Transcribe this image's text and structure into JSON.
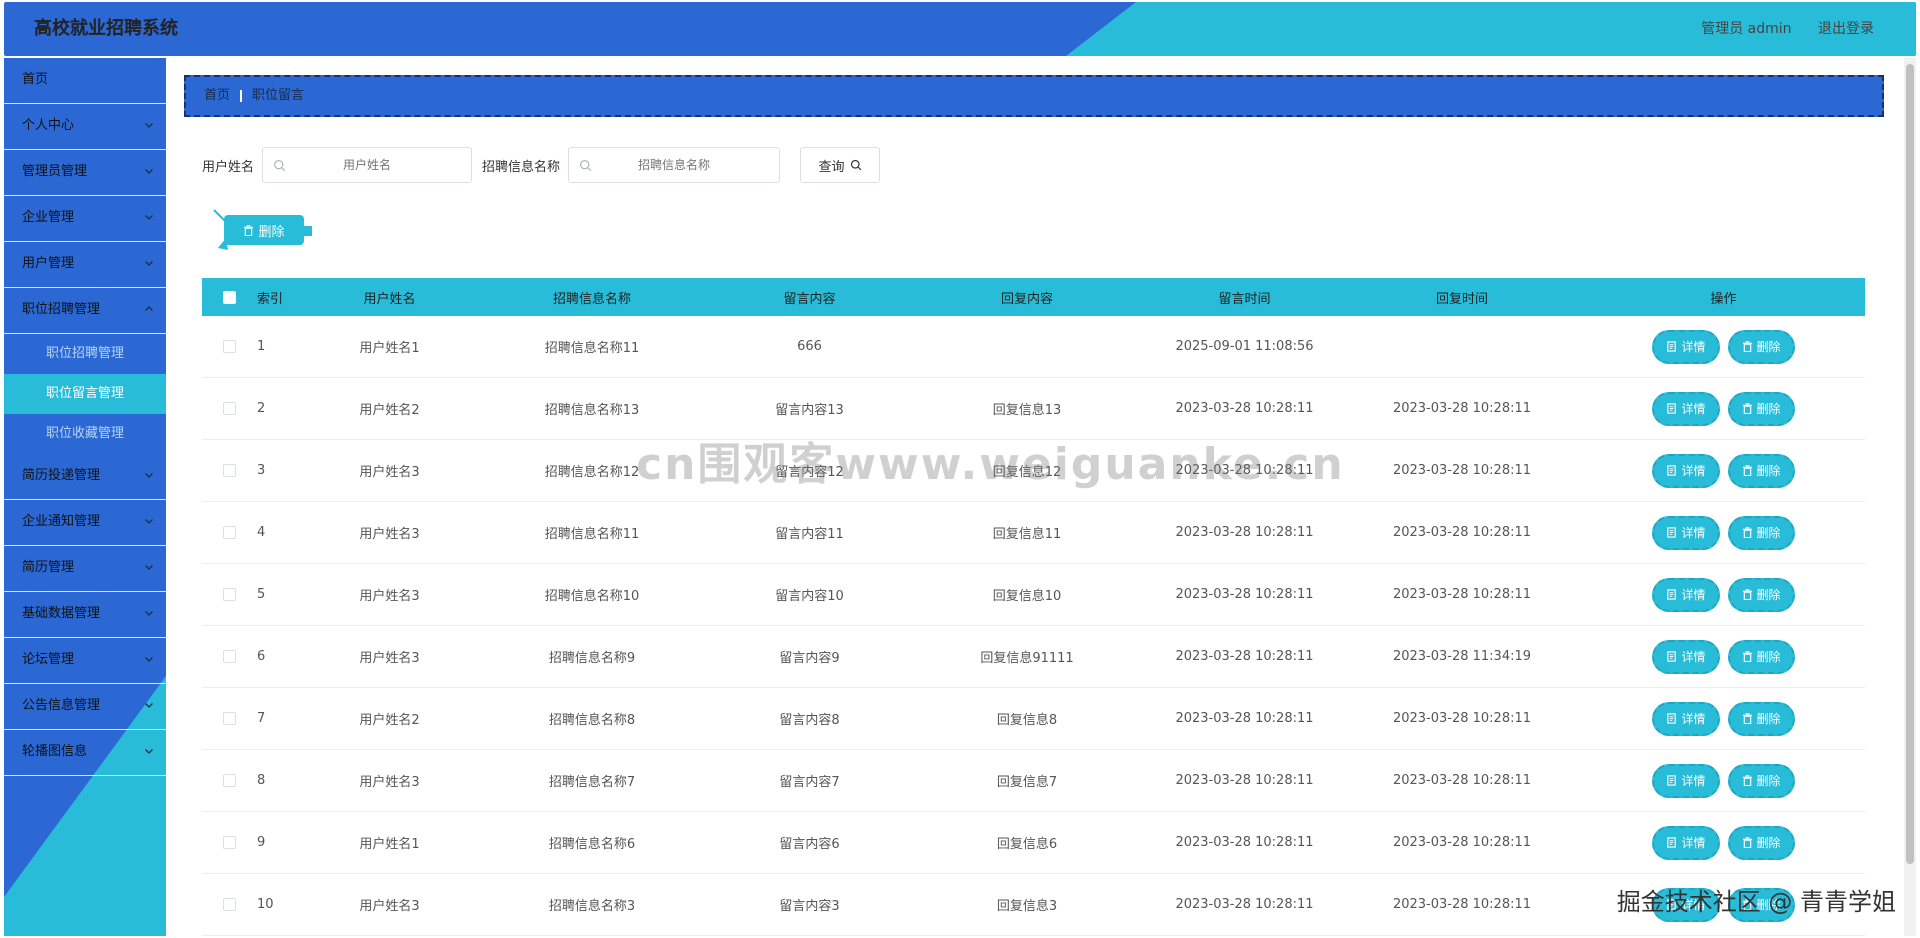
{
  "header": {
    "title": "高校就业招聘系统",
    "user_label": "管理员 admin",
    "logout_label": "退出登录"
  },
  "sidebar": {
    "items": [
      {
        "label": "首页",
        "has_children": false
      },
      {
        "label": "个人中心",
        "has_children": true
      },
      {
        "label": "管理员管理",
        "has_children": true
      },
      {
        "label": "企业管理",
        "has_children": true
      },
      {
        "label": "用户管理",
        "has_children": true
      },
      {
        "label": "职位招聘管理",
        "has_children": true,
        "expanded": true
      }
    ],
    "sub_items": [
      {
        "label": "职位招聘管理",
        "active": false
      },
      {
        "label": "职位留言管理",
        "active": true
      },
      {
        "label": "职位收藏管理",
        "active": false
      }
    ],
    "items_after": [
      {
        "label": "简历投递管理"
      },
      {
        "label": "企业通知管理"
      },
      {
        "label": "简历管理"
      },
      {
        "label": "基础数据管理"
      },
      {
        "label": "论坛管理"
      },
      {
        "label": "公告信息管理"
      },
      {
        "label": "轮播图信息"
      }
    ]
  },
  "breadcrumb": {
    "home": "首页",
    "current": "职位留言"
  },
  "search": {
    "user_label": "用户姓名",
    "user_placeholder": "用户姓名",
    "info_label": "招聘信息名称",
    "info_placeholder": "招聘信息名称",
    "query_label": "查询"
  },
  "toolbar": {
    "delete_label": "删除"
  },
  "table": {
    "headers": [
      "索引",
      "用户姓名",
      "招聘信息名称",
      "留言内容",
      "回复内容",
      "留言时间",
      "回复时间",
      "操作"
    ],
    "detail_label": "详情",
    "delete_label": "删除",
    "rows": [
      {
        "index": "1",
        "user": "用户姓名1",
        "info": "招聘信息名称11",
        "msg": "666",
        "reply": "",
        "msg_time": "2025-09-01 11:08:56",
        "reply_time": ""
      },
      {
        "index": "2",
        "user": "用户姓名2",
        "info": "招聘信息名称13",
        "msg": "留言内容13",
        "reply": "回复信息13",
        "msg_time": "2023-03-28 10:28:11",
        "reply_time": "2023-03-28 10:28:11"
      },
      {
        "index": "3",
        "user": "用户姓名3",
        "info": "招聘信息名称12",
        "msg": "留言内容12",
        "reply": "回复信息12",
        "msg_time": "2023-03-28 10:28:11",
        "reply_time": "2023-03-28 10:28:11"
      },
      {
        "index": "4",
        "user": "用户姓名3",
        "info": "招聘信息名称11",
        "msg": "留言内容11",
        "reply": "回复信息11",
        "msg_time": "2023-03-28 10:28:11",
        "reply_time": "2023-03-28 10:28:11"
      },
      {
        "index": "5",
        "user": "用户姓名3",
        "info": "招聘信息名称10",
        "msg": "留言内容10",
        "reply": "回复信息10",
        "msg_time": "2023-03-28 10:28:11",
        "reply_time": "2023-03-28 10:28:11"
      },
      {
        "index": "6",
        "user": "用户姓名3",
        "info": "招聘信息名称9",
        "msg": "留言内容9",
        "reply": "回复信息91111",
        "msg_time": "2023-03-28 10:28:11",
        "reply_time": "2023-03-28 11:34:19"
      },
      {
        "index": "7",
        "user": "用户姓名2",
        "info": "招聘信息名称8",
        "msg": "留言内容8",
        "reply": "回复信息8",
        "msg_time": "2023-03-28 10:28:11",
        "reply_time": "2023-03-28 10:28:11"
      },
      {
        "index": "8",
        "user": "用户姓名3",
        "info": "招聘信息名称7",
        "msg": "留言内容7",
        "reply": "回复信息7",
        "msg_time": "2023-03-28 10:28:11",
        "reply_time": "2023-03-28 10:28:11"
      },
      {
        "index": "9",
        "user": "用户姓名1",
        "info": "招聘信息名称6",
        "msg": "留言内容6",
        "reply": "回复信息6",
        "msg_time": "2023-03-28 10:28:11",
        "reply_time": "2023-03-28 10:28:11"
      },
      {
        "index": "10",
        "user": "用户姓名3",
        "info": "招聘信息名称3",
        "msg": "留言内容3",
        "reply": "回复信息3",
        "msg_time": "2023-03-28 10:28:11",
        "reply_time": "2023-03-28 10:28:11"
      }
    ]
  },
  "watermarks": {
    "center": "cn围观客www.weiguanke.cn",
    "corner": "掘金技术社区 @ 青青学姐"
  },
  "colors": {
    "primary_blue": "#2b68d4",
    "accent_cyan": "#29bcd8"
  }
}
